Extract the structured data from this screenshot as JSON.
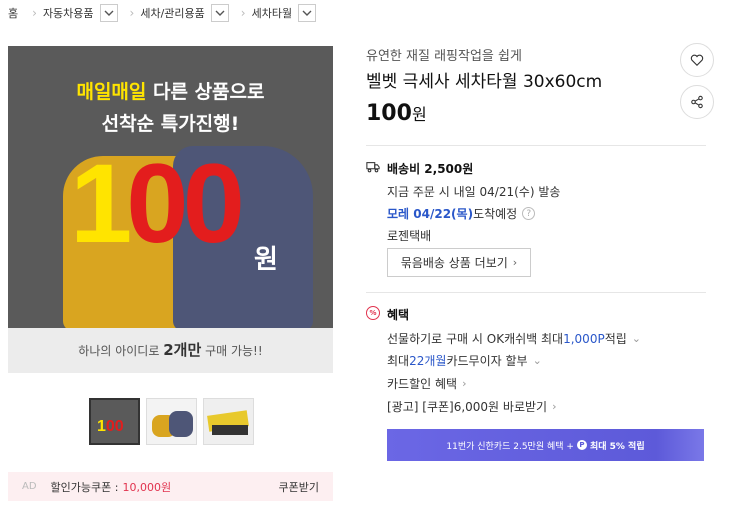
{
  "breadcrumb": {
    "home": "홈",
    "items": [
      "자동차용품",
      "세차/관리용품",
      "세차타월"
    ]
  },
  "image": {
    "promo_line1_yellow": "매일매일",
    "promo_line1_rest": " 다른 상품으로",
    "promo_line2": "선착순 특가진행!",
    "big_first": "1",
    "big_rest": "00",
    "won": "원",
    "caption_pre": "하나의 아이디로 ",
    "caption_bold": "2개만",
    "caption_post": " 구매 가능!!",
    "thumb1_a": "1",
    "thumb1_b": "00"
  },
  "ad": {
    "tag": "AD",
    "label": "할인가능쿠폰 :",
    "value": "10,000원",
    "button": "쿠폰받기"
  },
  "product": {
    "subtitle": "유연한 재질 래핑작업을 쉽게",
    "title": "벨벳 극세사 세차타월 30x60cm",
    "price": "100",
    "price_unit": "원"
  },
  "shipping": {
    "title": "배송비 2,500원",
    "line1": "지금 주문 시 내일 04/21(수) 발송",
    "arrival_highlight": "모레 04/22(목)",
    "arrival_rest": " 도착예정",
    "help": "?",
    "courier": "로젠택배",
    "bundle_button": "묶음배송 상품 더보기"
  },
  "benefit": {
    "icon_text": "%",
    "title": "혜택",
    "line1_pre": "선물하기로 구매 시 OK캐쉬백 최대 ",
    "line1_highlight": "1,000P",
    "line1_post": " 적립",
    "line2_pre": "최대 ",
    "line2_highlight": "22개월",
    "line2_post": " 카드무이자 할부",
    "line3": "카드할인 혜택",
    "line4": "[광고] [쿠폰]6,000원 바로받기"
  },
  "banner": {
    "pre": "11번가 신한카드 2.5만원 혜택 + ",
    "p": "P",
    "highlight": "최대 5% 적립"
  },
  "colors": {
    "accent_red": "#e1334e",
    "blue": "#2a57c9",
    "banner": "#5d5ad9",
    "promo_yellow": "#ffe400",
    "promo_red": "#e31d1d"
  }
}
